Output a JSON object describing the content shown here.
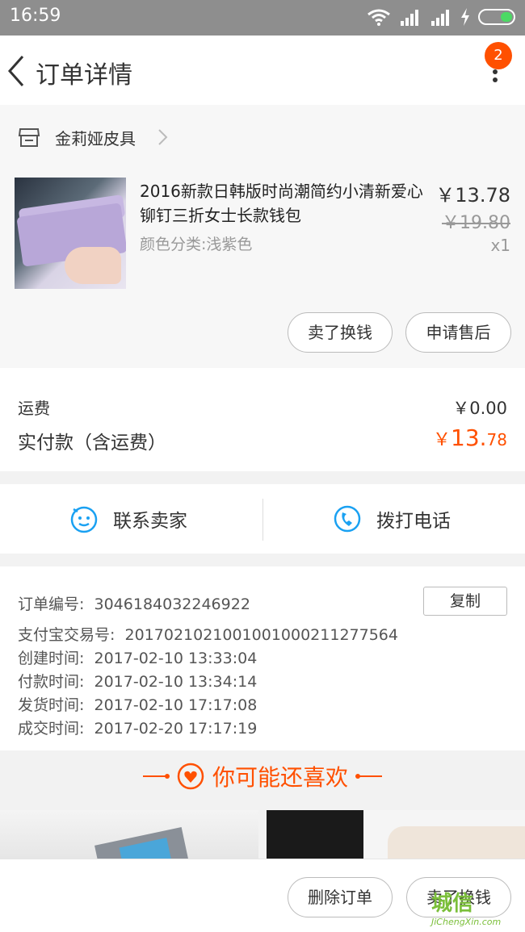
{
  "status_bar": {
    "time": "16:59"
  },
  "header": {
    "title": "订单详情",
    "badge_count": "2"
  },
  "shop": {
    "name": "金莉娅皮具"
  },
  "product": {
    "title": "2016新款日韩版时尚潮简约小清新爱心铆钉三折女士长款钱包",
    "sku": "颜色分类:浅紫色",
    "price": "￥13.78",
    "original_price": "￥19.80",
    "quantity": "x1",
    "buttons": {
      "sell": "卖了换钱",
      "after_sale": "申请售后"
    }
  },
  "fees": {
    "shipping_label": "运费",
    "shipping_value": "￥0.00",
    "paid_label": "实付款（含运费）",
    "paid_currency": "￥",
    "paid_int": "13.",
    "paid_dec": "78"
  },
  "contact": {
    "seller": "联系卖家",
    "call": "拨打电话"
  },
  "order": {
    "copy_label": "复制",
    "lines": [
      {
        "label": "订单编号:",
        "value": "3046184032246922"
      },
      {
        "label": "支付宝交易号:",
        "value": "2017021021001001000211277564"
      },
      {
        "label": "创建时间:",
        "value": "2017-02-10 13:33:04"
      },
      {
        "label": "付款时间:",
        "value": "2017-02-10 13:34:14"
      },
      {
        "label": "发货时间:",
        "value": "2017-02-10 17:17:08"
      },
      {
        "label": "成交时间:",
        "value": "2017-02-20 17:17:19"
      }
    ]
  },
  "recommend": {
    "title": "你可能还喜欢"
  },
  "bottom_bar": {
    "delete": "删除订单",
    "sell": "卖了换钱"
  },
  "watermark": {
    "text": "城信",
    "sub": "JiChengXin.com"
  },
  "colors": {
    "accent": "#ff5000",
    "watermark": "#7bbf3a",
    "contact_icon": "#1aa1f2"
  }
}
